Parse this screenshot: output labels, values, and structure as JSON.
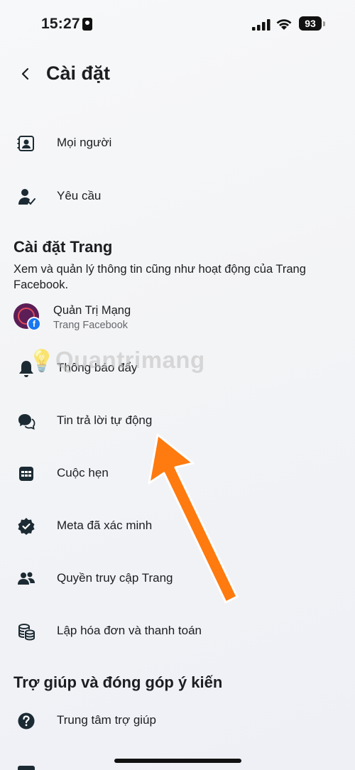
{
  "status_bar": {
    "time": "15:27",
    "battery": "93"
  },
  "header": {
    "title": "Cài đặt"
  },
  "top_items": [
    {
      "label": "Mọi người",
      "icon": "contacts-icon"
    },
    {
      "label": "Yêu cầu",
      "icon": "person-check-icon"
    }
  ],
  "page_settings": {
    "title": "Cài đặt Trang",
    "description": "Xem và quản lý thông tin cũng như hoạt động của Trang Facebook.",
    "page": {
      "name": "Quản Trị Mạng",
      "subtitle": "Trang Facebook"
    },
    "items": [
      {
        "label": "Thông báo đẩy",
        "icon": "bell-icon"
      },
      {
        "label": "Tin trả lời tự động",
        "icon": "chat-bubbles-icon"
      },
      {
        "label": "Cuộc hẹn",
        "icon": "calendar-icon"
      },
      {
        "label": "Meta đã xác minh",
        "icon": "verified-badge-icon"
      },
      {
        "label": "Quyền truy cập Trang",
        "icon": "people-icon"
      },
      {
        "label": "Lập hóa đơn và thanh toán",
        "icon": "coins-icon"
      }
    ]
  },
  "help": {
    "title": "Trợ giúp và đóng góp ý kiến",
    "items": [
      {
        "label": "Trung tâm trợ giúp",
        "icon": "question-circle-icon"
      }
    ]
  },
  "watermark": "Quantrimang",
  "colors": {
    "arrow": "#ff7a0f",
    "icon": "#1c2b33",
    "facebook_blue": "#1877f2"
  }
}
